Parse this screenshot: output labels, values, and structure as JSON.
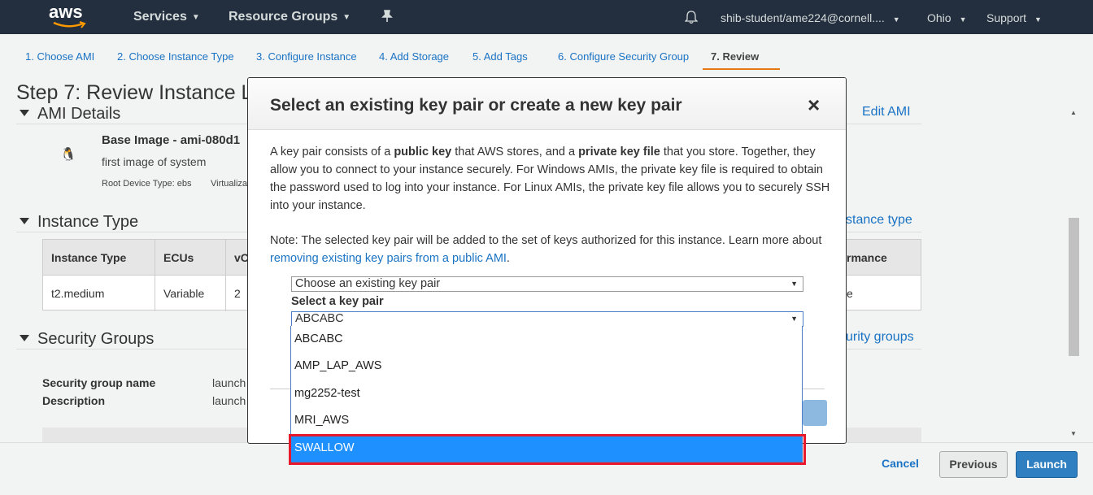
{
  "nav": {
    "logo": "aws",
    "services": "Services",
    "resource_groups": "Resource Groups",
    "account": "shib-student/ame224@cornell....",
    "region": "Ohio",
    "support": "Support"
  },
  "steps": [
    {
      "label": "1. Choose AMI"
    },
    {
      "label": "2. Choose Instance Type"
    },
    {
      "label": "3. Configure Instance"
    },
    {
      "label": "4. Add Storage"
    },
    {
      "label": "5. Add Tags"
    },
    {
      "label": "6. Configure Security Group"
    },
    {
      "label": "7. Review"
    }
  ],
  "page": {
    "title": "Step 7: Review Instance L",
    "ami_section": "AMI Details",
    "edit_ami": "Edit AMI",
    "base_image": "Base Image - ami-080d1",
    "ami_desc": "first image of system",
    "root_device": "Root Device Type: ebs",
    "virtualization": "Virtualiza",
    "instance_section": "Instance Type",
    "edit_instance": "stance type",
    "table_headers": [
      "Instance Type",
      "ECUs",
      "vC",
      "rmance"
    ],
    "table_row": [
      "t2.medium",
      "Variable",
      "2",
      "e"
    ],
    "security_section": "Security Groups",
    "edit_security": "urity groups",
    "sg_name_label": "Security group name",
    "sg_name_value": "launch",
    "desc_label": "Description",
    "desc_value": "launch"
  },
  "footer": {
    "cancel": "Cancel",
    "previous": "Previous",
    "launch": "Launch"
  },
  "modal": {
    "title": "Select an existing key pair or create a new key pair",
    "close": "×",
    "p1_a": "A key pair consists of a ",
    "p1_b": "public key",
    "p1_c": " that AWS stores, and a ",
    "p1_d": "private key file",
    "p1_e": " that you store. Together, they allow you to connect to your instance securely. For Windows AMIs, the private key file is required to obtain the password used to log into your instance. For Linux AMIs, the private key file allows you to securely SSH into your instance.",
    "note_a": "Note: The selected key pair will be added to the set of keys authorized for this instance. Learn more about ",
    "note_link": "removing existing key pairs from a public AMI",
    "note_b": ".",
    "mode_select": "Choose an existing key pair",
    "select_label": "Select a key pair",
    "selected_key": "ABCABC",
    "options": [
      "ABCABC",
      "AMP_LAP_AWS",
      "mg2252-test",
      "MRI_AWS",
      "SWALLOW"
    ],
    "highlighted_option": "SWALLOW"
  }
}
